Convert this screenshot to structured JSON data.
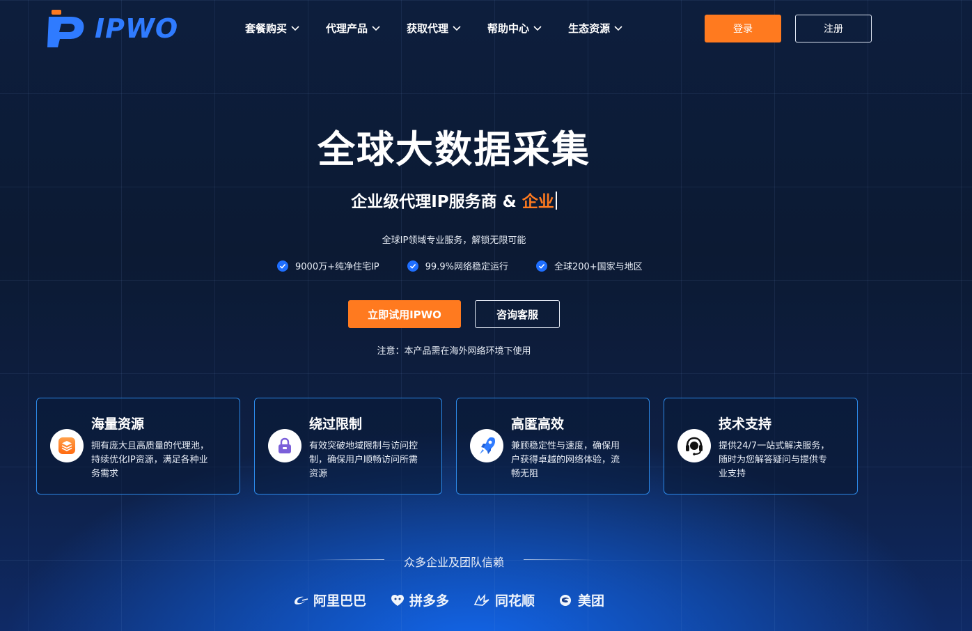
{
  "brand": {
    "name": "IPWO"
  },
  "nav": [
    {
      "label": "套餐购买"
    },
    {
      "label": "代理产品"
    },
    {
      "label": "获取代理"
    },
    {
      "label": "帮助中心"
    },
    {
      "label": "生态资源"
    }
  ],
  "auth": {
    "login": "登录",
    "register": "注册"
  },
  "hero": {
    "title": "全球大数据采集",
    "subtitle_prefix": "企业级代理IP服务商 & ",
    "subtitle_accent": "企业",
    "description": "全球IP领域专业服务，解锁无限可能",
    "features": [
      {
        "label": "9000万+纯净住宅IP"
      },
      {
        "label": "99.9%网络稳定运行"
      },
      {
        "label": "全球200+国家与地区"
      }
    ],
    "cta_primary": "立即试用IPWO",
    "cta_secondary": "咨询客服",
    "notice": "注意：本产品需在海外网络环境下使用"
  },
  "cards": [
    {
      "icon": "layers-icon",
      "title": "海量资源",
      "lines": [
        "拥有庞大且高质量的代理池，",
        "持续优化IP资源，满足各种业",
        "务需求"
      ]
    },
    {
      "icon": "lock-icon",
      "title": "绕过限制",
      "lines": [
        "有效突破地域限制与访问控",
        "制，确保用户顺畅访问所需",
        "资源"
      ]
    },
    {
      "icon": "rocket-icon",
      "title": "高匿高效",
      "lines": [
        "兼顾稳定性与速度，确保用",
        "户获得卓越的网络体验，流",
        "畅无阻"
      ]
    },
    {
      "icon": "headset-icon",
      "title": "技术支持",
      "lines": [
        "提供24/7一站式解决服务，",
        "随时为您解答疑问与提供专",
        "业支持"
      ]
    }
  ],
  "trusted": {
    "title": "众多企业及团队信赖",
    "partners": [
      {
        "icon": "alibaba-logo-icon",
        "name": "阿里巴巴"
      },
      {
        "icon": "pinduoduo-logo-icon",
        "name": "拼多多"
      },
      {
        "icon": "tonghuashun-logo-icon",
        "name": "同花顺"
      },
      {
        "icon": "meituan-logo-icon",
        "name": "美团"
      }
    ]
  },
  "colors": {
    "accent": "#ff7a1f",
    "brand_blue": "#2f7bff",
    "card_border": "#2c89e8"
  }
}
